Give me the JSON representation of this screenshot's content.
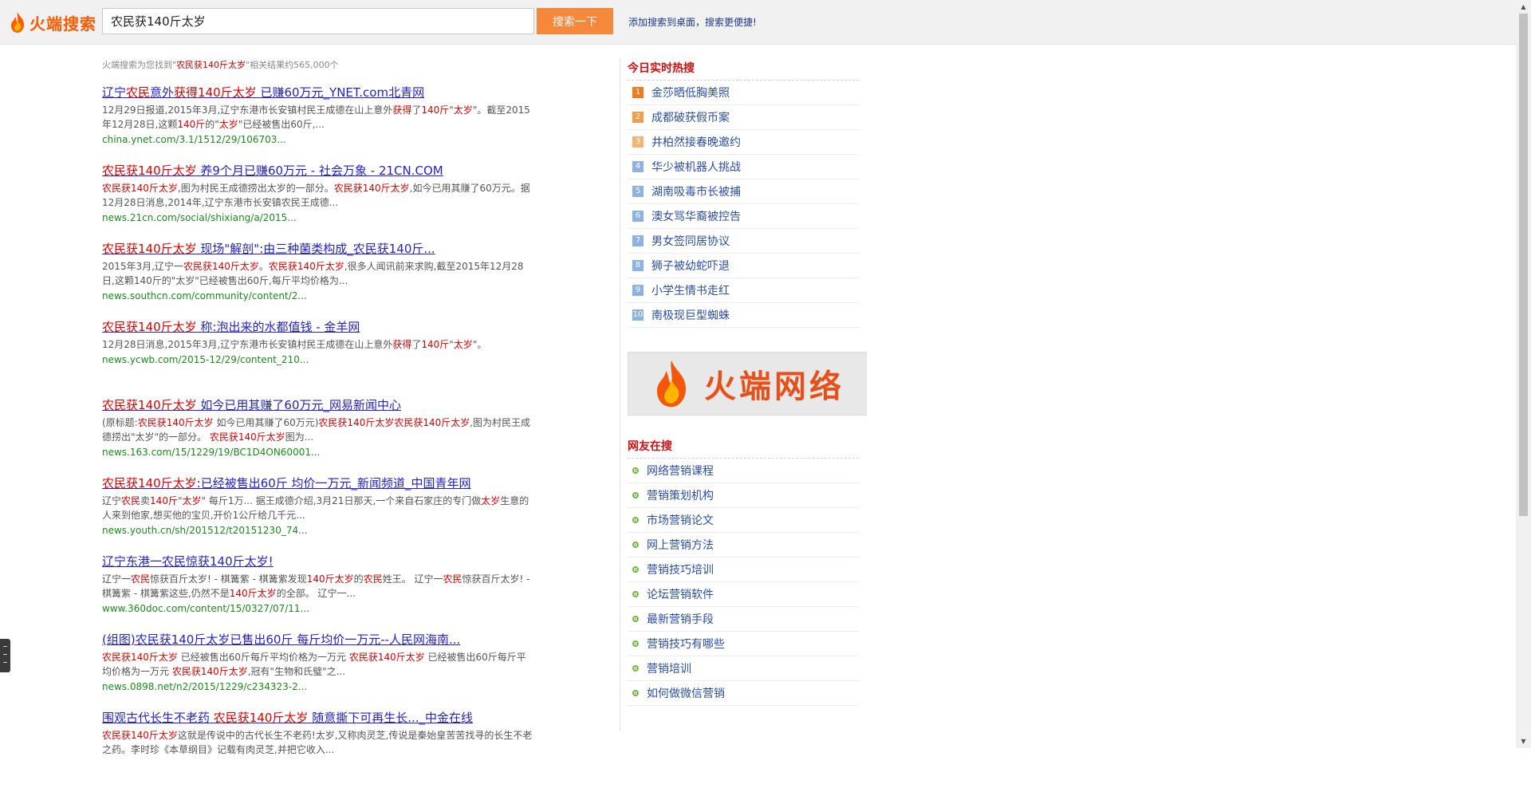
{
  "header": {
    "logo_text": "火端搜索",
    "search_value": "农民获140斤太岁",
    "search_button": "搜索一下",
    "add_desktop": "添加搜索到桌面，搜索更便捷!"
  },
  "result_count": {
    "prefix": "火端搜索为您找到\"",
    "query": "农民获140斤太岁",
    "suffix": "\"相关结果约565,000个"
  },
  "results": [
    {
      "title": [
        {
          "t": "辽宁",
          "h": false
        },
        {
          "t": "农民",
          "h": true
        },
        {
          "t": "意外",
          "h": false
        },
        {
          "t": "获得140斤太岁",
          "h": true
        },
        {
          "t": " 已赚60万元_YNET.com北青网",
          "h": false
        }
      ],
      "snippet": [
        {
          "t": "12月29日报道,2015年3月,辽宁东港市长安镇村民王成德在山上意外",
          "h": false
        },
        {
          "t": "获得",
          "h": true
        },
        {
          "t": "了",
          "h": false
        },
        {
          "t": "140斤",
          "h": true
        },
        {
          "t": "\"",
          "h": false
        },
        {
          "t": "太岁",
          "h": true
        },
        {
          "t": "\"。截至2015年12月28日,这颗",
          "h": false
        },
        {
          "t": "140斤",
          "h": true
        },
        {
          "t": "的\"",
          "h": false
        },
        {
          "t": "太岁",
          "h": true
        },
        {
          "t": "\"已经被售出60斤,...",
          "h": false
        }
      ],
      "url": "china.ynet.com/3.1/1512/29/106703..."
    },
    {
      "title": [
        {
          "t": "农民获140斤太岁",
          "h": true
        },
        {
          "t": " 养9个月已赚60万元 - 社会万象 - 21CN.COM",
          "h": false
        }
      ],
      "snippet": [
        {
          "t": "农民获140斤太岁",
          "h": true
        },
        {
          "t": ",图为村民王成德捞出太岁的一部分。",
          "h": false
        },
        {
          "t": "农民获140斤太岁",
          "h": true
        },
        {
          "t": ",如今已用其赚了60万元。据12月28日消息,2014年,辽宁东港市长安镇农民王成德...",
          "h": false
        }
      ],
      "url": "news.21cn.com/social/shixiang/a/2015..."
    },
    {
      "title": [
        {
          "t": "农民获140斤太岁",
          "h": true
        },
        {
          "t": " 现场\"解剖\":由三种菌类构成_农民获140斤...",
          "h": false
        }
      ],
      "snippet": [
        {
          "t": "2015年3月,辽宁一",
          "h": false
        },
        {
          "t": "农民获140斤太岁",
          "h": true
        },
        {
          "t": "。",
          "h": false
        },
        {
          "t": "农民获140斤太岁",
          "h": true
        },
        {
          "t": ",很多人闻讯前来求购,截至2015年12月28日,这颗140斤的\"太岁\"已经被售出60斤,每斤平均价格为...",
          "h": false
        }
      ],
      "url": "news.southcn.com/community/content/2..."
    },
    {
      "title": [
        {
          "t": "农民获140斤太岁",
          "h": true
        },
        {
          "t": " 称:泡出来的水都值钱 - 金羊网",
          "h": false
        }
      ],
      "snippet": [
        {
          "t": "12月28日消息,2015年3月,辽宁东港市长安镇村民王成德在山上意外",
          "h": false
        },
        {
          "t": "获得",
          "h": true
        },
        {
          "t": "了",
          "h": false
        },
        {
          "t": "140斤",
          "h": true
        },
        {
          "t": "\"",
          "h": false
        },
        {
          "t": "太岁",
          "h": true
        },
        {
          "t": "\"。",
          "h": false
        }
      ],
      "url": "news.ycwb.com/2015-12/29/content_210..."
    },
    {
      "title": [
        {
          "t": "农民获140斤太岁",
          "h": true
        },
        {
          "t": " 如今已用其赚了60万元_网易新闻中心",
          "h": false
        }
      ],
      "snippet": [
        {
          "t": "(原标题:",
          "h": false
        },
        {
          "t": "农民获140斤太岁",
          "h": true
        },
        {
          "t": " 如今已用其赚了60万元)",
          "h": false
        },
        {
          "t": "农民获140斤太岁农民获140斤太岁",
          "h": true
        },
        {
          "t": ",图为村民王成德捞出\"太岁\"的一部分。 ",
          "h": false
        },
        {
          "t": "农民获140斤太岁",
          "h": true
        },
        {
          "t": "图为...",
          "h": false
        }
      ],
      "url": "news.163.com/15/1229/19/BC1D4ON60001..."
    },
    {
      "title": [
        {
          "t": "农民获140斤太岁",
          "h": true
        },
        {
          "t": ":已经被售出60斤 均价一万元_新闻频道_中国青年网",
          "h": false
        }
      ],
      "snippet": [
        {
          "t": "辽宁",
          "h": false
        },
        {
          "t": "农民",
          "h": true
        },
        {
          "t": "卖",
          "h": false
        },
        {
          "t": "140斤",
          "h": true
        },
        {
          "t": "\"",
          "h": false
        },
        {
          "t": "太岁",
          "h": true
        },
        {
          "t": "\" 每斤1万... 据王成德介绍,3月21日那天,一个来自石家庄的专门做",
          "h": false
        },
        {
          "t": "太岁",
          "h": true
        },
        {
          "t": "生意的人来到他家,想买他的宝贝,开价1公斤给几千元...",
          "h": false
        }
      ],
      "url": "news.youth.cn/sh/201512/t20151230_74..."
    },
    {
      "title": [
        {
          "t": "辽宁东港一农民惊获140斤太岁!",
          "h": false
        }
      ],
      "snippet": [
        {
          "t": "辽宁一",
          "h": false
        },
        {
          "t": "农民",
          "h": true
        },
        {
          "t": "惊获百斤太岁! - 棋篝紫 - 棋篝紫发现",
          "h": false
        },
        {
          "t": "140斤太岁",
          "h": true
        },
        {
          "t": "的",
          "h": false
        },
        {
          "t": "农民",
          "h": true
        },
        {
          "t": "姓王。 辽宁一",
          "h": false
        },
        {
          "t": "农民",
          "h": true
        },
        {
          "t": "惊获百斤太岁! - 棋篝紫 - 棋篝紫这些,仍然不是",
          "h": false
        },
        {
          "t": "140斤太岁",
          "h": true
        },
        {
          "t": "的全部。 辽宁一...",
          "h": false
        }
      ],
      "url": "www.360doc.com/content/15/0327/07/11..."
    },
    {
      "title": [
        {
          "t": "(组图)农民获140斤太岁已售出60斤 每斤均价一万元--人民网海南...",
          "h": false
        }
      ],
      "snippet": [
        {
          "t": "农民获140斤太岁",
          "h": true
        },
        {
          "t": " 已经被售出60斤每斤平均价格为一万元 ",
          "h": false
        },
        {
          "t": "农民获140斤太岁",
          "h": true
        },
        {
          "t": " 已经被售出60斤每斤平均价格为一万元 ",
          "h": false
        },
        {
          "t": "农民获140斤太岁",
          "h": true
        },
        {
          "t": ",冠有\"生物和氏璧\"之...",
          "h": false
        }
      ],
      "url": "news.0898.net/n2/2015/1229/c234323-2..."
    },
    {
      "title": [
        {
          "t": "围观古代长生不老药 ",
          "h": false
        },
        {
          "t": "农民获140斤太岁",
          "h": true
        },
        {
          "t": " 随意撕下可再生长..._中金在线",
          "h": false
        }
      ],
      "snippet": [
        {
          "t": "农民获140斤太岁",
          "h": true
        },
        {
          "t": "这就是传说中的古代长生不老药!太岁,又称肉灵芝,传说是秦始皇苦苦找寻的长生不老之药。李时珍《本草纲目》记载有肉灵芝,并把它收入...",
          "h": false
        }
      ],
      "url": ""
    }
  ],
  "sidebar": {
    "hot_title": "今日实时热搜",
    "hot_items": [
      {
        "rank": "1",
        "label": "金莎晒低胸美照"
      },
      {
        "rank": "2",
        "label": "成都破获假币案"
      },
      {
        "rank": "3",
        "label": "井柏然接春晚邀约"
      },
      {
        "rank": "4",
        "label": "华少被机器人挑战"
      },
      {
        "rank": "5",
        "label": "湖南吸毒市长被捕"
      },
      {
        "rank": "6",
        "label": "澳女骂华裔被控告"
      },
      {
        "rank": "7",
        "label": "男女签同居协议"
      },
      {
        "rank": "8",
        "label": "狮子被幼蛇吓退"
      },
      {
        "rank": "9",
        "label": "小学生情书走红"
      },
      {
        "rank": "10",
        "label": "南极现巨型蜘蛛"
      }
    ],
    "banner_text": "火端网络",
    "net_title": "网友在搜",
    "net_items": [
      "网络营销课程",
      "营销策划机构",
      "市场营销论文",
      "网上营销方法",
      "营销技巧培训",
      "论坛营销软件",
      "最新营销手段",
      "营销技巧有哪些",
      "营销培训",
      "如何做微信营销"
    ]
  },
  "colors": {
    "brand": "#ff5a00",
    "button": "#f6883b",
    "link": "#2323c8",
    "highlight": "#d00",
    "url": "#1a8c1a"
  }
}
